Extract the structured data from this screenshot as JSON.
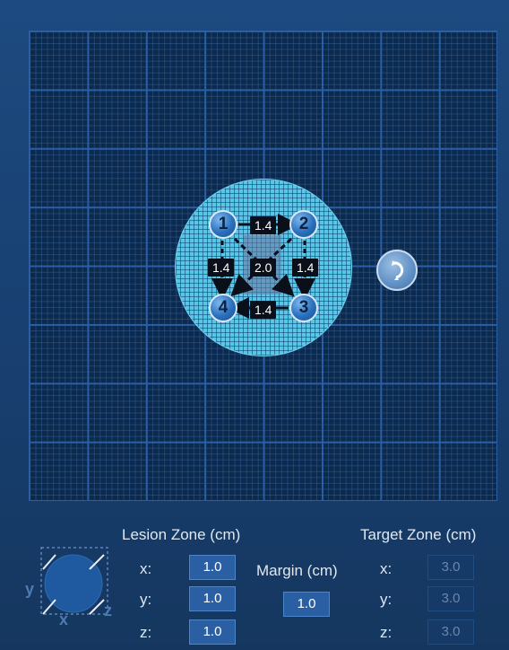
{
  "canvas": {
    "nodes": [
      {
        "id": "1",
        "label": "1"
      },
      {
        "id": "2",
        "label": "2"
      },
      {
        "id": "3",
        "label": "3"
      },
      {
        "id": "4",
        "label": "4"
      }
    ],
    "distances": {
      "d12": "1.4",
      "d23": "1.4",
      "d34": "1.4",
      "d14": "1.4",
      "diag": "2.0"
    }
  },
  "rotate_icon": "rotate-icon",
  "axis_icon": {
    "y": "y",
    "x": "x",
    "z": "z"
  },
  "lesion_zone": {
    "title": "Lesion Zone (cm)",
    "x_label": "x:",
    "x_value": "1.0",
    "y_label": "y:",
    "y_value": "1.0",
    "z_label": "z:",
    "z_value": "1.0"
  },
  "margin": {
    "title": "Margin (cm)",
    "value": "1.0"
  },
  "target_zone": {
    "title": "Target Zone (cm)",
    "x_label": "x:",
    "x_value": "3.0",
    "y_label": "y:",
    "y_value": "3.0",
    "z_label": "z:",
    "z_value": "3.0"
  },
  "colors": {
    "background": "#1d4a80",
    "grid": "#2a5fa6",
    "lesion": "#59c6e6",
    "field": "#2b5fa3"
  }
}
